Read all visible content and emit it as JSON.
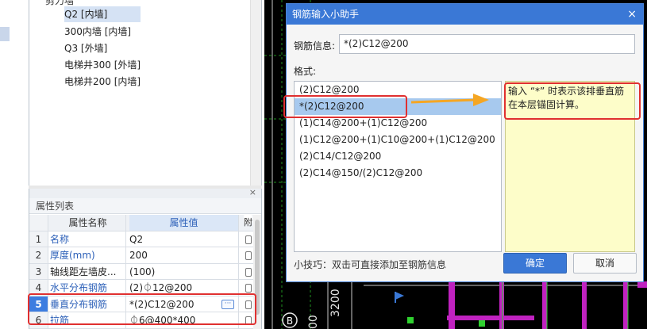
{
  "tree": {
    "header": "剪力墙",
    "items": [
      {
        "label": "Q2 [内墙]",
        "selected": true
      },
      {
        "label": "300内墙 [内墙]",
        "selected": false
      },
      {
        "label": "Q3 [外墙]",
        "selected": false
      },
      {
        "label": "电梯井300 [外墙]",
        "selected": false
      },
      {
        "label": "电梯井200 [内墙]",
        "selected": false
      }
    ]
  },
  "properties": {
    "panel_title": "属性列表",
    "close_glyph": "×",
    "col_name": "属性名称",
    "col_value": "属性值",
    "col_extra": "附",
    "rows": [
      {
        "index": "1",
        "name": "名称",
        "value": "Q2"
      },
      {
        "index": "2",
        "name": "厚度(mm)",
        "value": "200"
      },
      {
        "index": "3",
        "name": "轴线距左墙皮...",
        "value": "(100)"
      },
      {
        "index": "4",
        "name": "水平分布钢筋",
        "value": "(2)⏀12@200"
      },
      {
        "index": "5",
        "name": "垂直分布钢筋",
        "value": "*(2)C12@200"
      },
      {
        "index": "6",
        "name": "拉筋",
        "value": "⏀6@400*400"
      }
    ],
    "more_glyph": "···"
  },
  "dialog": {
    "title": "钢筋输入小助手",
    "close_glyph": "×",
    "info_label": "钢筋信息:",
    "info_value": "*(2)C12@200",
    "format_label": "格式:",
    "formats": [
      "(2)C12@200",
      "*(2)C12@200",
      "(1)C14@200+(1)C12@200",
      "(1)C12@200+(1)C10@200+(1)C12@200",
      "(2)C14/C12@200",
      "(2)C14@150/(2)C12@200"
    ],
    "selected_format_index": 1,
    "tip_text": "输入 “*” 时表示该排垂直筋在本层锚固计算。",
    "hint": "小技巧：双击可直接添加至钢筋信息",
    "ok_label": "确定",
    "cancel_label": "取消"
  },
  "cad": {
    "dimension_text": "3200",
    "dimension_text_2": "00",
    "axis_label": "B"
  },
  "colors": {
    "accent": "#3a78d6",
    "annotation_red": "#e03030",
    "arrow_yellow": "#f5a623",
    "tip_bg": "#fdfdc9",
    "cad_bg": "#000000",
    "cad_magenta": "#c022c0",
    "cad_green": "#2fd12f"
  }
}
